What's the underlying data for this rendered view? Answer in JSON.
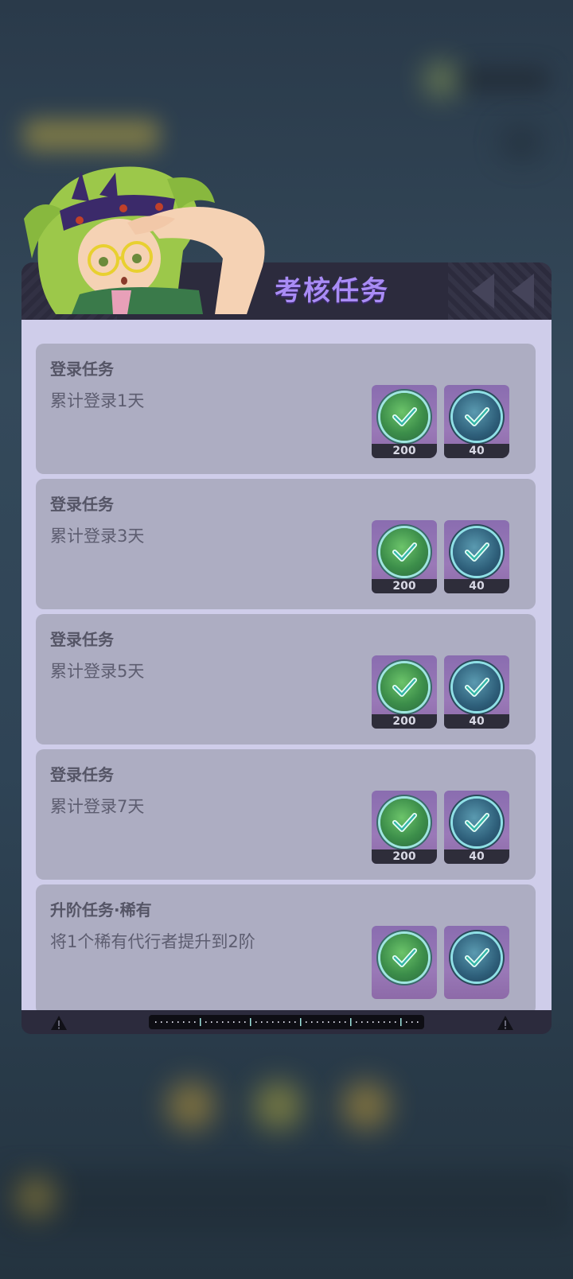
{
  "dialog": {
    "title": "考核任务"
  },
  "tasks": [
    {
      "title": "登录任务",
      "description": "累计登录1天",
      "rewards": [
        {
          "icon": "green-check-coin-icon",
          "count": "200"
        },
        {
          "icon": "blue-check-badge-icon",
          "count": "40"
        }
      ]
    },
    {
      "title": "登录任务",
      "description": "累计登录3天",
      "rewards": [
        {
          "icon": "green-check-coin-icon",
          "count": "200"
        },
        {
          "icon": "blue-check-badge-icon",
          "count": "40"
        }
      ]
    },
    {
      "title": "登录任务",
      "description": "累计登录5天",
      "rewards": [
        {
          "icon": "green-check-coin-icon",
          "count": "200"
        },
        {
          "icon": "blue-check-badge-icon",
          "count": "40"
        }
      ]
    },
    {
      "title": "登录任务",
      "description": "累计登录7天",
      "rewards": [
        {
          "icon": "green-check-coin-icon",
          "count": "200"
        },
        {
          "icon": "blue-check-badge-icon",
          "count": "40"
        }
      ]
    },
    {
      "title": "升阶任务·稀有",
      "description": "将1个稀有代行者提升到2阶",
      "rewards": [
        {
          "icon": "green-check-coin-icon",
          "count": ""
        },
        {
          "icon": "blue-check-badge-icon",
          "count": ""
        }
      ]
    }
  ],
  "colors": {
    "title": "#a98cf5",
    "panel": "#cfcdea",
    "card": "#adadc2",
    "reward_bg": "#8a6db0"
  }
}
